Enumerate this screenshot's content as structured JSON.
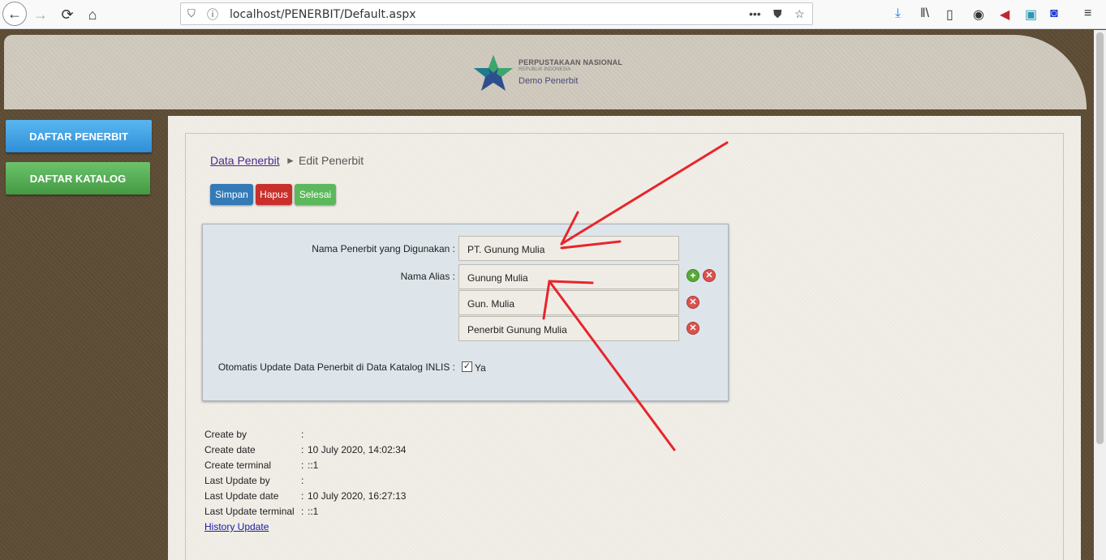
{
  "browser": {
    "url": "localhost/PENERBIT/Default.aspx",
    "more_label": "•••"
  },
  "header": {
    "logo_line1": "PERPUSTAKAAN NASIONAL",
    "logo_line2": "REPUBLIK INDONESIA",
    "logo_line3": "Demo Penerbit"
  },
  "sidebar": {
    "items": [
      {
        "label": "DAFTAR PENERBIT"
      },
      {
        "label": "DAFTAR KATALOG"
      }
    ]
  },
  "breadcrumb": {
    "parent": "Data Penerbit",
    "separator": "►",
    "current": "Edit Penerbit"
  },
  "actions": {
    "simpan": "Simpan",
    "hapus": "Hapus",
    "selesai": "Selesai"
  },
  "form": {
    "nama_penerbit_label": "Nama Penerbit yang Digunakan :",
    "nama_penerbit_value": "PT. Gunung Mulia",
    "alias_label": "Nama Alias :",
    "aliases": [
      "Gunung Mulia",
      "Gun. Mulia",
      "Penerbit Gunung Mulia"
    ],
    "auto_update_label": "Otomatis Update Data Penerbit di Data Katalog INLIS :",
    "auto_update_checked": true,
    "auto_update_option": "Ya"
  },
  "meta": {
    "rows": [
      {
        "label": "Create by",
        "value": ""
      },
      {
        "label": "Create date",
        "value": "10 July 2020, 14:02:34"
      },
      {
        "label": "Create terminal",
        "value": "::1"
      },
      {
        "label": "Last Update by",
        "value": ""
      },
      {
        "label": "Last Update date",
        "value": "10 July 2020, 16:27:13"
      },
      {
        "label": "Last Update terminal",
        "value": "::1"
      }
    ],
    "colon": ":",
    "history_link": "History Update"
  },
  "colors": {
    "annotation_arrow": "#e8252b",
    "simpan": "#337ab7",
    "hapus": "#c9302c",
    "selesai": "#5cb85c"
  }
}
